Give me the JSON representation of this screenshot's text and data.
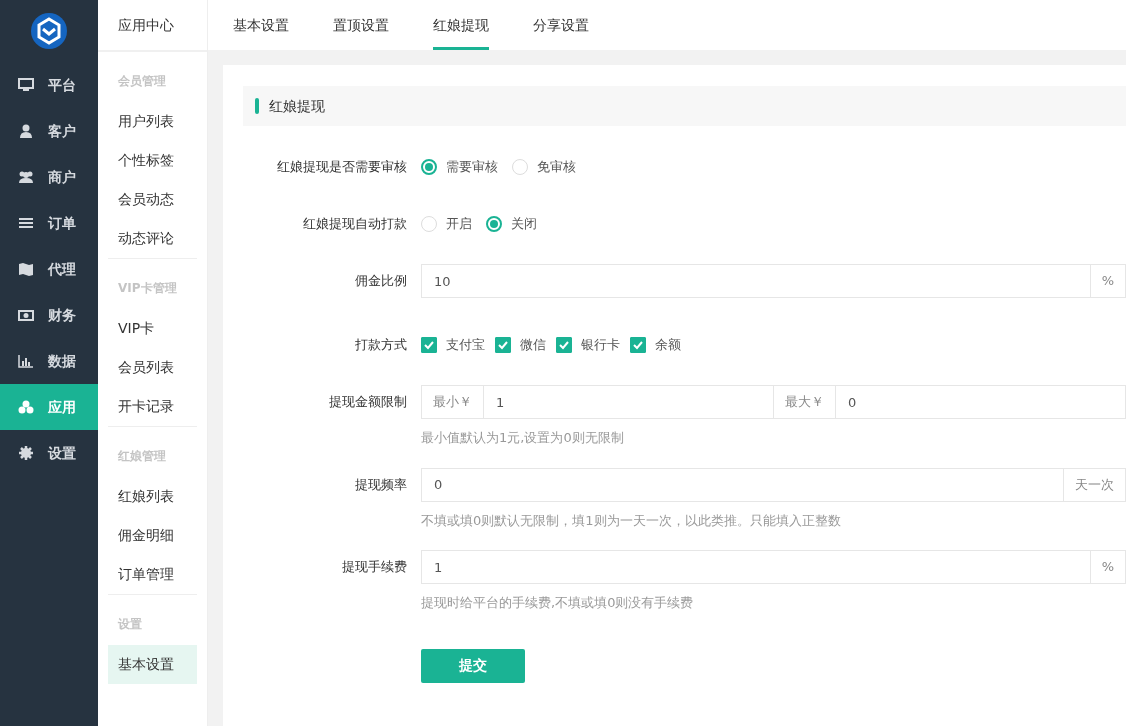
{
  "nav": [
    {
      "label": "平台",
      "selected": false
    },
    {
      "label": "客户",
      "selected": false
    },
    {
      "label": "商户",
      "selected": false
    },
    {
      "label": "订单",
      "selected": false
    },
    {
      "label": "代理",
      "selected": false
    },
    {
      "label": "财务",
      "selected": false
    },
    {
      "label": "数据",
      "selected": false
    },
    {
      "label": "应用",
      "selected": true
    },
    {
      "label": "设置",
      "selected": false
    }
  ],
  "subnav": {
    "title": "应用中心",
    "groups": [
      {
        "heading": "会员管理",
        "items": [
          {
            "label": "用户列表",
            "selected": false
          },
          {
            "label": "个性标签",
            "selected": false
          },
          {
            "label": "会员动态",
            "selected": false
          },
          {
            "label": "动态评论",
            "selected": false
          }
        ]
      },
      {
        "heading": "VIP卡管理",
        "items": [
          {
            "label": "VIP卡",
            "selected": false
          },
          {
            "label": "会员列表",
            "selected": false
          },
          {
            "label": "开卡记录",
            "selected": false
          }
        ]
      },
      {
        "heading": "红娘管理",
        "items": [
          {
            "label": "红娘列表",
            "selected": false
          },
          {
            "label": "佣金明细",
            "selected": false
          },
          {
            "label": "订单管理",
            "selected": false
          }
        ]
      },
      {
        "heading": "设置",
        "items": [
          {
            "label": "基本设置",
            "selected": true
          }
        ]
      }
    ]
  },
  "tabs": [
    {
      "label": "基本设置",
      "selected": false
    },
    {
      "label": "置顶设置",
      "selected": false
    },
    {
      "label": "红娘提现",
      "selected": true
    },
    {
      "label": "分享设置",
      "selected": false
    }
  ],
  "section_title": "红娘提现",
  "form": {
    "fields": [
      {
        "kind": "radio",
        "label": "红娘提现是否需要审核",
        "options": [
          {
            "label": "需要审核",
            "selected": true
          },
          {
            "label": "免审核",
            "selected": false
          }
        ]
      },
      {
        "kind": "radio",
        "label": "红娘提现自动打款",
        "options": [
          {
            "label": "开启",
            "selected": false
          },
          {
            "label": "关闭",
            "selected": true
          }
        ]
      },
      {
        "kind": "input",
        "label": "佣金比例",
        "value": "10",
        "suffix": "%"
      },
      {
        "kind": "checkbox",
        "label": "打款方式",
        "options": [
          {
            "label": "支付宝",
            "checked": true
          },
          {
            "label": "微信",
            "checked": true
          },
          {
            "label": "银行卡",
            "checked": true
          },
          {
            "label": "余额",
            "checked": true
          }
        ]
      },
      {
        "kind": "range",
        "label": "提现金额限制",
        "parts": [
          {
            "prefix": "最小￥",
            "value": "1"
          },
          {
            "prefix": "最大￥",
            "value": "0"
          }
        ],
        "hint": "最小值默认为1元,设置为0则无限制"
      },
      {
        "kind": "input",
        "label": "提现频率",
        "value": "0",
        "suffix": "天一次",
        "hint": "不填或填0则默认无限制，填1则为一天一次，以此类推。只能填入正整数"
      },
      {
        "kind": "input",
        "label": "提现手续费",
        "value": "1",
        "suffix": "%",
        "hint": "提现时给平台的手续费,不填或填0则没有手续费"
      }
    ],
    "submit": "提交"
  }
}
